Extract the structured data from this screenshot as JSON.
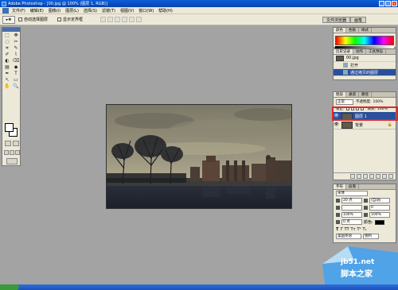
{
  "window": {
    "title": "Adobe Photoshop - [00.jpg @ 100% (图层 1, RGB)]",
    "controls": {
      "minimize": "_",
      "maximize": "□",
      "close": "×"
    }
  },
  "menu": [
    "文件(F)",
    "编辑(E)",
    "图像(I)",
    "图层(L)",
    "选择(S)",
    "滤镜(T)",
    "视图(V)",
    "窗口(W)",
    "帮助(H)"
  ],
  "options": {
    "auto_select_label": "自动选择图层",
    "show_bounds_label": "显示定界框",
    "palette_tabs": [
      "文件浏览器",
      "画笔"
    ]
  },
  "toolbox": {
    "tools": [
      "⬚",
      "✥",
      "◌",
      "✂",
      "⌗",
      "✎",
      "✐",
      "⌇",
      "◐",
      "⌫",
      "▤",
      "◆",
      "✒",
      "T",
      "↖",
      "▭",
      "✋",
      "🔍"
    ],
    "fg_color": "#ffffff",
    "bg_color": "#ffffff"
  },
  "color_panel": {
    "tabs": [
      "颜色",
      "色板",
      "样式"
    ]
  },
  "history_panel": {
    "tabs": [
      "历史记录",
      "动作",
      "工具预设"
    ],
    "snapshot": "00.jpg",
    "steps": [
      "打开",
      "通过拷贝的图层"
    ]
  },
  "layers_panel": {
    "tabs": [
      "图层",
      "通道",
      "路径"
    ],
    "blend_mode": "正常",
    "opacity_label": "不透明度:",
    "opacity_value": "100%",
    "lock_label": "锁定:",
    "fill_label": "填充:",
    "fill_value": "100%",
    "layers": [
      {
        "name": "图层 1",
        "selected": true
      },
      {
        "name": "背景",
        "selected": false
      }
    ]
  },
  "character_panel": {
    "tabs": [
      "字符",
      "段落"
    ],
    "font_family": "宋体",
    "font_size": "20 点",
    "leading": "(自动)",
    "tracking": "0",
    "vertical_scale": "100%",
    "horizontal_scale": "100%",
    "baseline_shift": "0 点",
    "color_label": "颜色:",
    "language": "美国英语",
    "antialias": "锐利"
  },
  "watermark": {
    "url": "jb51.net",
    "site": "脚本之家"
  },
  "colors": {
    "title_bar": "#0a5fd8",
    "workspace": "#a3a3a3",
    "selection": "#2a4f9c",
    "highlight": "#e3262b"
  }
}
